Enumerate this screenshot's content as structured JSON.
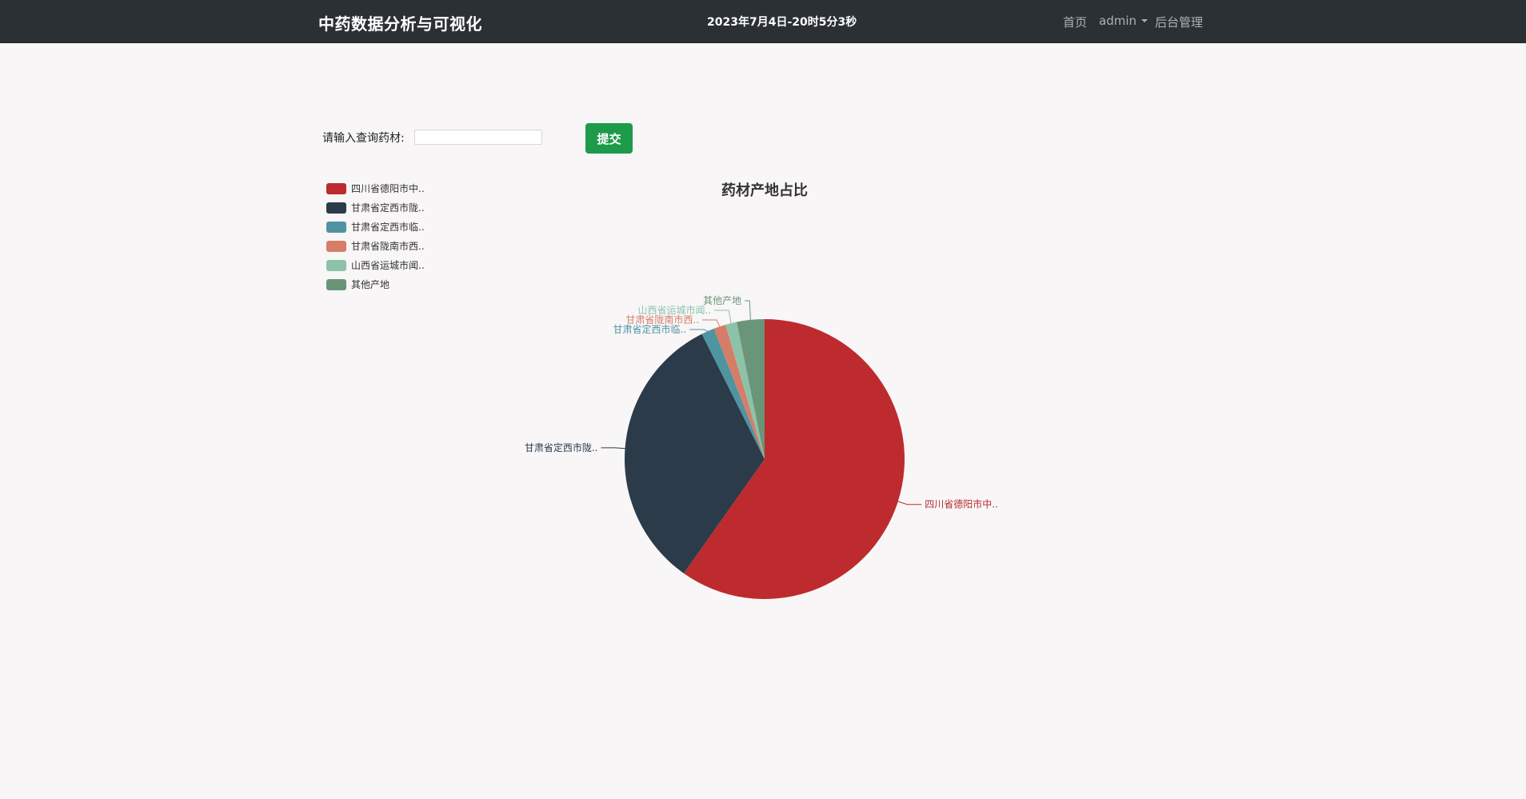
{
  "navbar": {
    "brand": "中药数据分析与可视化",
    "clock": "2023年7月4日-20时5分3秒",
    "home": "首页",
    "user": "admin",
    "admin": "后台管理"
  },
  "query": {
    "label": "请输入查询药材:",
    "placeholder": "",
    "value": "",
    "submit_label": "提交"
  },
  "chart_data": {
    "type": "pie",
    "title": "药材产地占比",
    "legend_position": "top-left",
    "slices": [
      {
        "name": "四川省德阳市中..",
        "value": 59.8,
        "color": "#bd2b2e"
      },
      {
        "name": "甘肃省定西市陇..",
        "value": 32.8,
        "color": "#2b3b4a"
      },
      {
        "name": "甘肃省定西市临..",
        "value": 1.5,
        "color": "#4f94a1"
      },
      {
        "name": "甘肃省陇南市西..",
        "value": 1.4,
        "color": "#d67d68"
      },
      {
        "name": "山西省运城市闻..",
        "value": 1.3,
        "color": "#8cc3a8"
      },
      {
        "name": "其他产地",
        "value": 3.2,
        "color": "#6a9579"
      }
    ]
  }
}
